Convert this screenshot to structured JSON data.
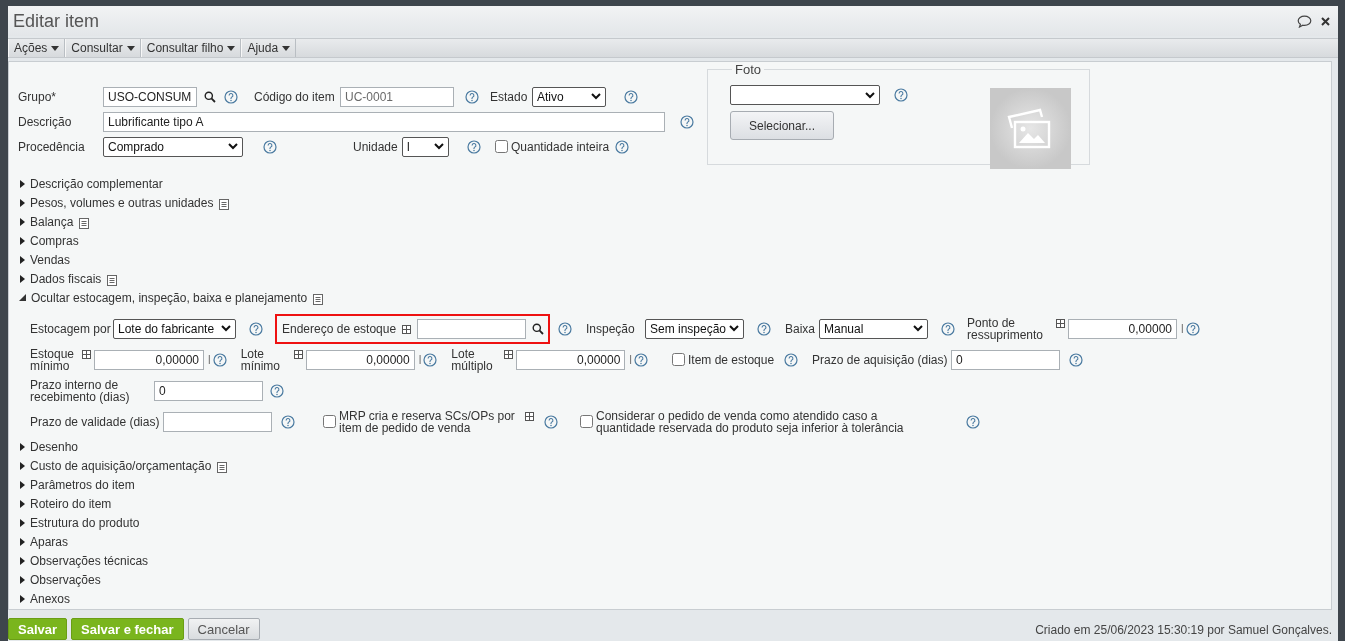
{
  "window": {
    "title": "Editar item"
  },
  "menu": [
    {
      "label": "Ações"
    },
    {
      "label": "Consultar"
    },
    {
      "label": "Consultar filho"
    },
    {
      "label": "Ajuda"
    }
  ],
  "general": {
    "field_lines": [
      {
        "fields": [
          {
            "kind": "input",
            "label": "Grupo*",
            "value": "USO-CONSUM",
            "search": true,
            "disabled": false
          },
          {
            "kind": "input",
            "label": "Código do item",
            "value": "UC-0001",
            "search": false,
            "disabled": true
          },
          {
            "kind": "select",
            "label": "Estado",
            "value": "Ativo"
          }
        ]
      },
      {
        "fields": [
          {
            "kind": "input",
            "label": "Descrição",
            "value": "Lubrificante tipo A",
            "search": false,
            "disabled": false
          }
        ]
      },
      {
        "fields": [
          {
            "kind": "select",
            "label": "Procedência",
            "value": "Comprado"
          },
          {
            "kind": "select",
            "label": "Unidade",
            "value": "l"
          },
          {
            "kind": "checkbox",
            "label": "Quantidade inteira",
            "checked": false
          }
        ]
      }
    ]
  },
  "photo": {
    "legend": "Foto",
    "button": "Selecionar..."
  },
  "sections": [
    {
      "label": "Descrição complementar",
      "expanded": false,
      "note": false
    },
    {
      "label": "Pesos, volumes e outras unidades",
      "expanded": false,
      "note": true
    },
    {
      "label": "Balança",
      "expanded": false,
      "note": true
    },
    {
      "label": "Compras",
      "expanded": false,
      "note": false
    },
    {
      "label": "Vendas",
      "expanded": false,
      "note": false
    },
    {
      "label": "Dados fiscais",
      "expanded": false,
      "note": true
    },
    {
      "label": "Ocultar estocagem, inspeção, baixa e planejamento",
      "expanded": true,
      "note": true,
      "field_lines": [
        {
          "fields": [
            {
              "kind": "select",
              "label": "Estocagem por",
              "value": "Lote do fabricante"
            },
            {
              "kind": "input",
              "label": "Endereço de estoque",
              "grid": true,
              "search": true,
              "highlighted": true
            },
            {
              "kind": "select",
              "label": "Inspeção",
              "value": "Sem inspeção"
            },
            {
              "kind": "select",
              "label": "Baixa",
              "value": "Manual"
            },
            {
              "kind": "number",
              "label": "Ponto de ressuprimento",
              "grid": true,
              "value": "0,00000",
              "unit": "l"
            }
          ]
        },
        {
          "fields": [
            {
              "kind": "number",
              "label": "Estoque mínimo",
              "grid": true,
              "value": "0,00000",
              "unit": "l"
            },
            {
              "kind": "number",
              "label": "Lote mínimo",
              "grid": true,
              "value": "0,00000",
              "unit": "l"
            },
            {
              "kind": "number",
              "label": "Lote múltiplo",
              "grid": true,
              "value": "0,00000",
              "unit": "l"
            },
            {
              "kind": "checkbox",
              "label": "Item de estoque",
              "checked": false
            },
            {
              "kind": "input",
              "label": "Prazo de aquisição (dias)",
              "value": "0",
              "grid": false,
              "search": false,
              "disabled": false
            }
          ]
        },
        {
          "fields": [
            {
              "kind": "input",
              "label": "Prazo interno de recebimento (dias)",
              "value": "0",
              "grid": false,
              "search": false,
              "disabled": false
            }
          ]
        },
        {
          "fields": [
            {
              "kind": "input",
              "label": "Prazo de validade (dias)",
              "grid": false,
              "search": false
            },
            {
              "kind": "checkbox",
              "label": "MRP cria e reserva SCs/OPs por item de pedido de venda",
              "grid": true,
              "checked": false
            },
            {
              "kind": "checkbox",
              "label": "Considerar o pedido de venda como atendido caso a quantidade reservada do produto seja inferior à tolerância",
              "checked": false
            }
          ]
        }
      ]
    },
    {
      "label": "Desenho",
      "expanded": false,
      "note": false
    },
    {
      "label": "Custo de aquisição/orçamentação",
      "expanded": false,
      "note": true
    },
    {
      "label": "Parâmetros do item",
      "expanded": false,
      "note": false
    },
    {
      "label": "Roteiro do item",
      "expanded": false,
      "note": false
    },
    {
      "label": "Estrutura do produto",
      "expanded": false,
      "note": false
    },
    {
      "label": "Aparas",
      "expanded": false,
      "note": false
    },
    {
      "label": "Observações técnicas",
      "expanded": false,
      "note": false
    },
    {
      "label": "Observações",
      "expanded": false,
      "note": false
    },
    {
      "label": "Anexos",
      "expanded": false,
      "note": false
    }
  ],
  "footer": {
    "buttons": [
      {
        "label": "Salvar",
        "kind": "primary"
      },
      {
        "label": "Salvar e fechar",
        "kind": "primary"
      },
      {
        "label": "Cancelar",
        "kind": "secondary"
      }
    ],
    "info": "Criado em 25/06/2023 15:30:19 por Samuel Gonçalves."
  }
}
